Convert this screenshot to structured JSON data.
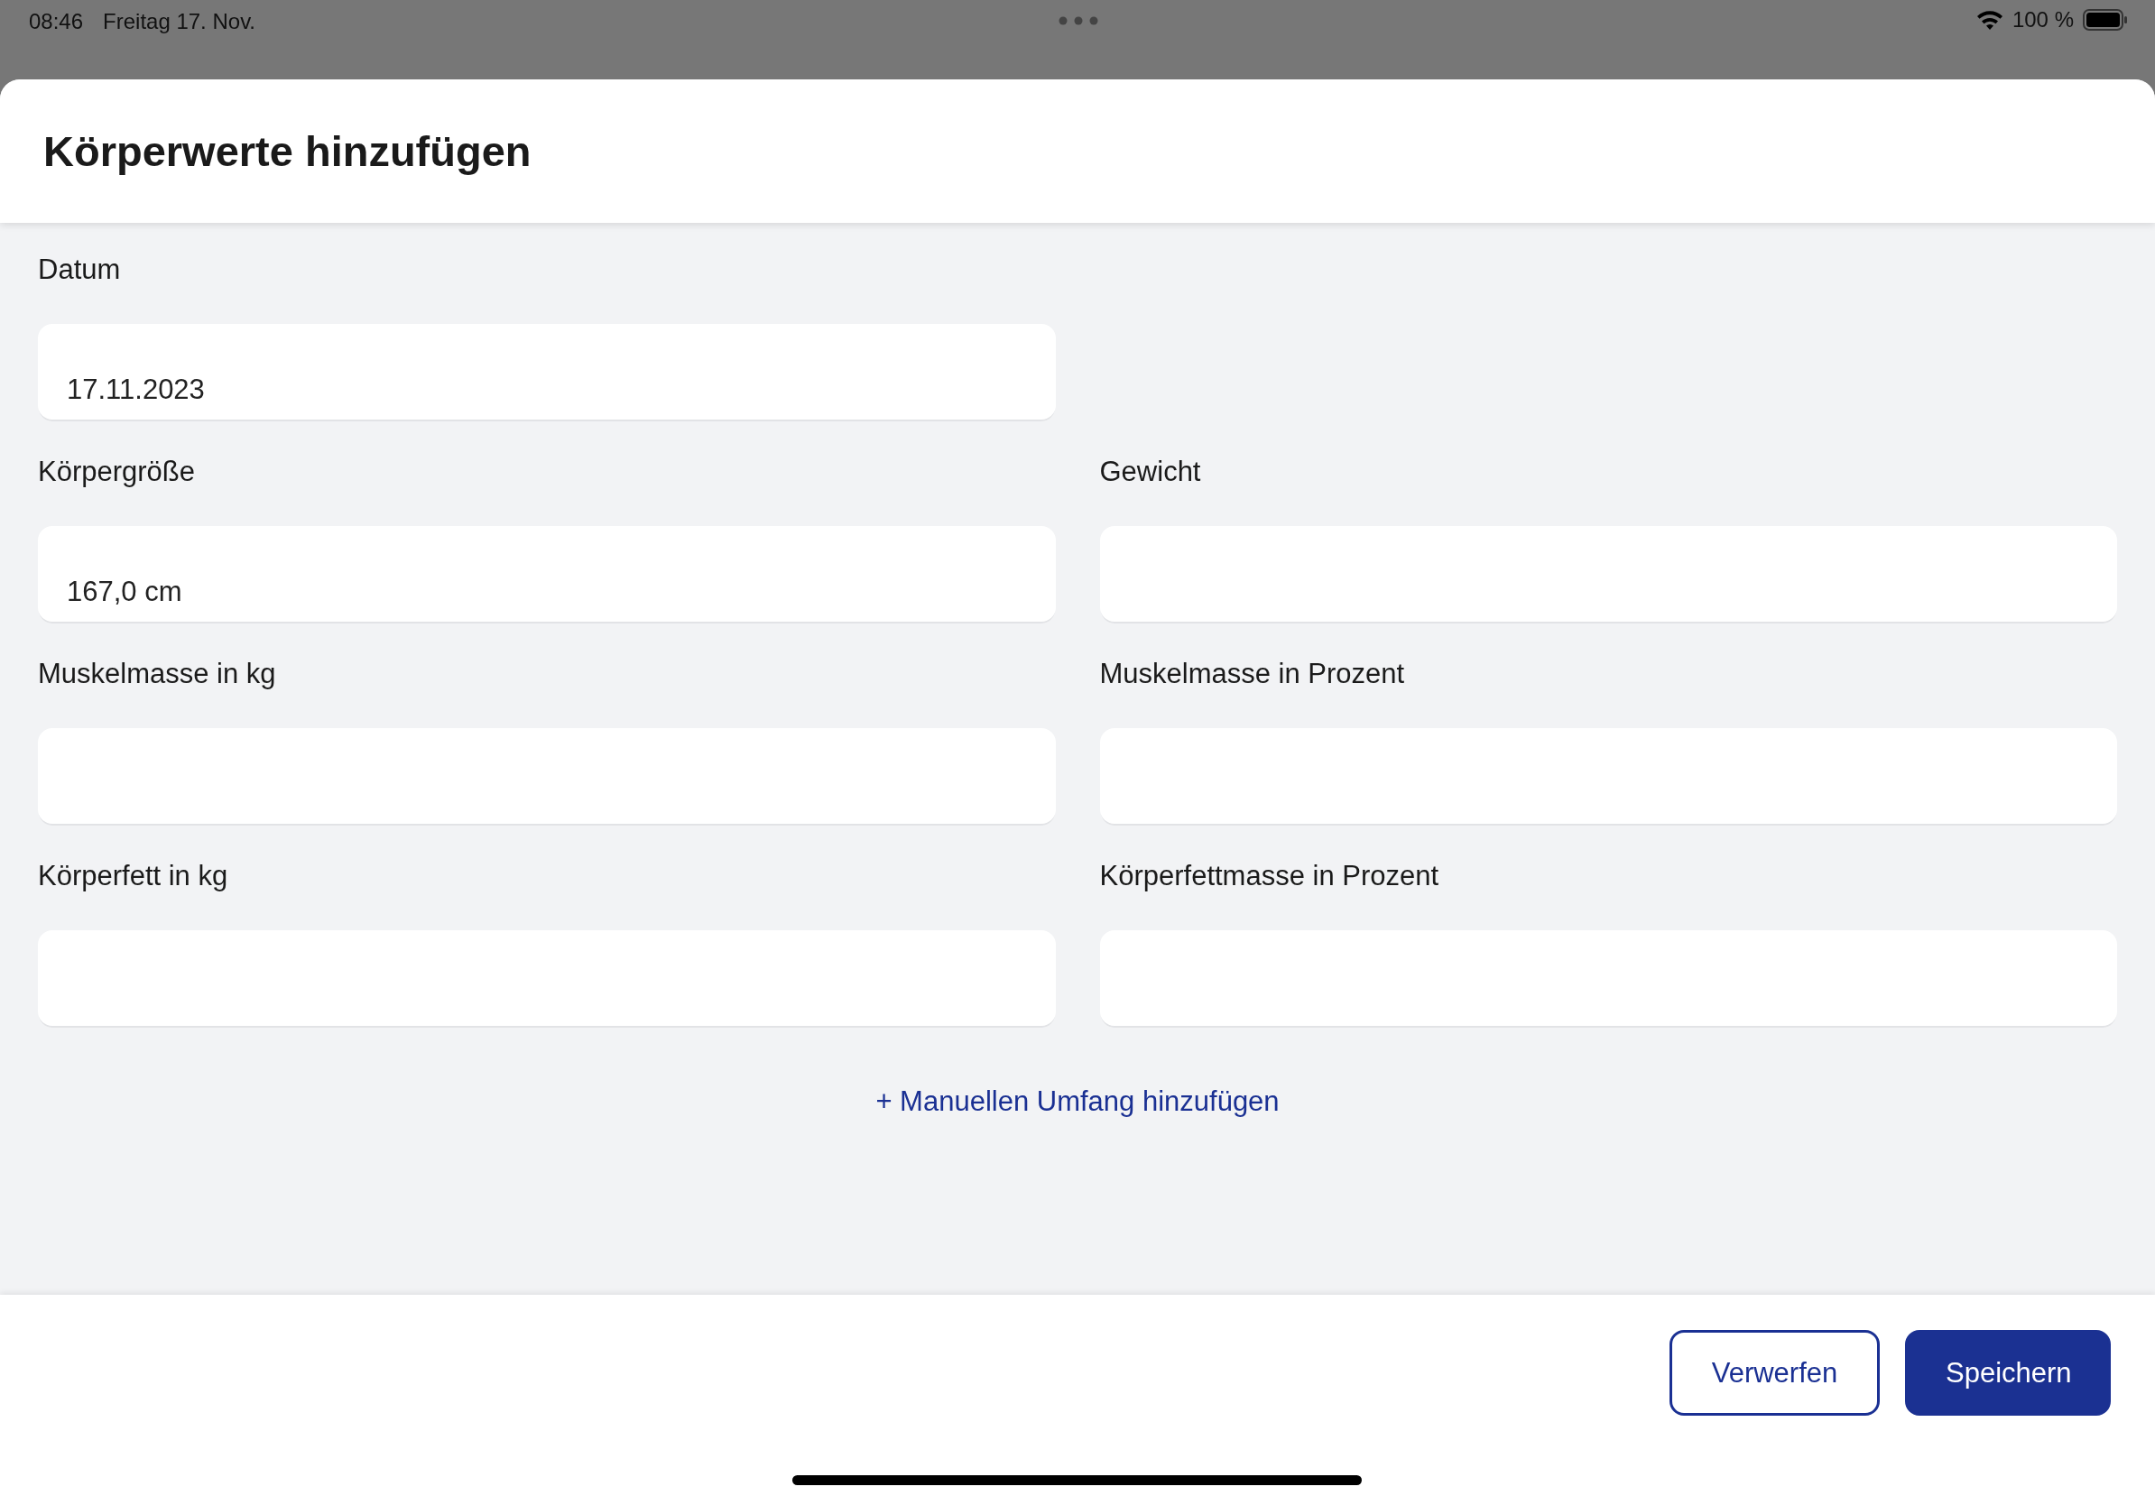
{
  "status_bar": {
    "time": "08:46",
    "date": "Freitag 17. Nov.",
    "battery": "100 %"
  },
  "sheet": {
    "title": "Körperwerte hinzufügen"
  },
  "form_rows": [
    [
      {
        "label": "Datum",
        "value": "17.11.2023"
      }
    ],
    [
      {
        "label": "Körpergröße",
        "value": "167,0 cm"
      },
      {
        "label": "Gewicht"
      }
    ],
    [
      {
        "label": "Muskelmasse in kg"
      },
      {
        "label": "Muskelmasse in Prozent"
      }
    ],
    [
      {
        "label": "Körperfett in kg"
      },
      {
        "label": "Körperfettmasse in Prozent"
      }
    ]
  ],
  "add_link": "+ Manuellen Umfang hinzufügen",
  "buttons": [
    {
      "label": "Verwerfen",
      "kind": "secondary"
    },
    {
      "label": "Speichern",
      "kind": "primary"
    }
  ]
}
